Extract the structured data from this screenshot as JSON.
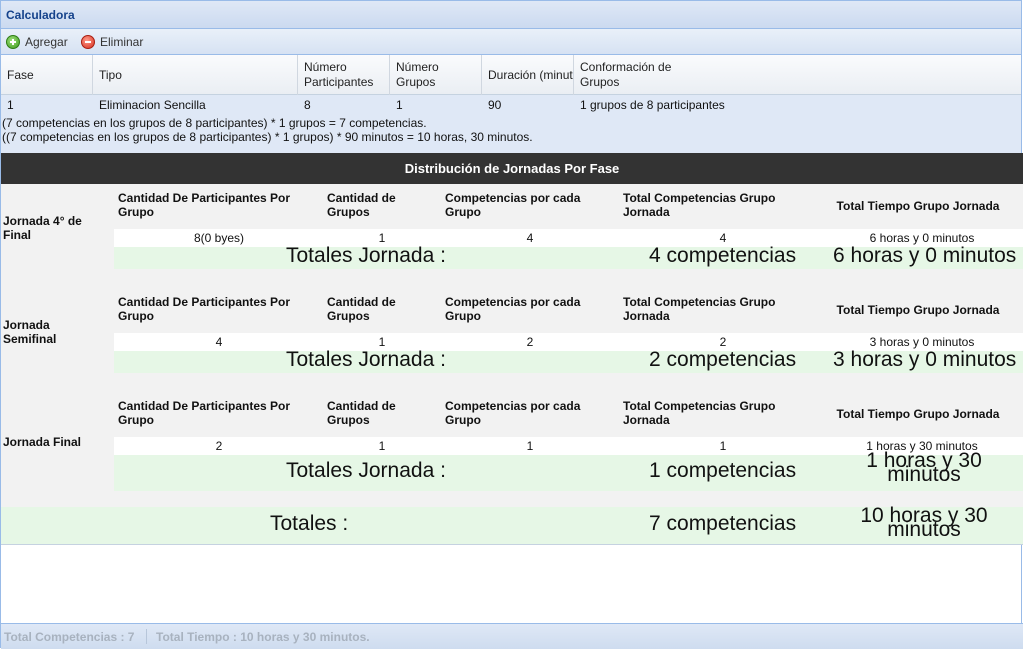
{
  "panel": {
    "title": "Calculadora"
  },
  "toolbar": {
    "add_label": "Agregar",
    "remove_label": "Eliminar"
  },
  "grid": {
    "headers": {
      "fase": "Fase",
      "tipo": "Tipo",
      "num_part_1": "Número",
      "num_part_2": "Participantes",
      "num_grp_1": "Número",
      "num_grp_2": "Grupos",
      "duracion": "Duración (minutos)",
      "conf_1": "Conformación de",
      "conf_2": "Grupos"
    },
    "row": {
      "fase": "1",
      "tipo": "Eliminacion Sencilla",
      "participantes": "8",
      "grupos": "1",
      "duracion": "90",
      "conformacion": "1 grupos de 8 participantes"
    },
    "calc_line_1": "(7 competencias en los grupos de 8 participantes) * 1 grupos = 7 competencias.",
    "calc_line_2": "((7 competencias en los grupos de 8 participantes) * 1 grupos) * 90 minutos = 10 horas, 30 minutos."
  },
  "distribution": {
    "title": "Distribución de Jornadas Por Fase",
    "col_headers": {
      "participantes": "Cantidad De Participantes Por Grupo",
      "grupos": "Cantidad de Grupos",
      "competencias": "Competencias por cada Grupo",
      "total_comp": "Total Competencias Grupo Jornada",
      "total_tiempo": "Total Tiempo Grupo Jornada"
    },
    "totales_jornada_label": "Totales Jornada :",
    "sections": [
      {
        "label": "Jornada 4° de Final",
        "participantes": "8(0 byes)",
        "grupos": "1",
        "competencias": "4",
        "total_comp": "4",
        "total_tiempo": "6 horas y 0 minutos",
        "tot_comp": "4 competencias",
        "tot_tiempo": "6 horas y 0 minutos"
      },
      {
        "label": "Jornada Semifinal",
        "participantes": "4",
        "grupos": "1",
        "competencias": "2",
        "total_comp": "2",
        "total_tiempo": "3 horas y 0 minutos",
        "tot_comp": "2 competencias",
        "tot_tiempo": "3 horas y 0 minutos"
      },
      {
        "label": "Jornada Final",
        "participantes": "2",
        "grupos": "1",
        "competencias": "1",
        "total_comp": "1",
        "total_tiempo": "1 horas y 30 minutos",
        "tot_comp": "1 competencias",
        "tot_tiempo": "1 horas y 30 minutos"
      }
    ],
    "grand": {
      "label": "Totales :",
      "competencias": "7 competencias",
      "tiempo": "10 horas y 30 minutos"
    }
  },
  "status": {
    "total_competencias": "Total Competencias : 7",
    "total_tiempo": "Total Tiempo : 10 horas y 30 minutos."
  }
}
